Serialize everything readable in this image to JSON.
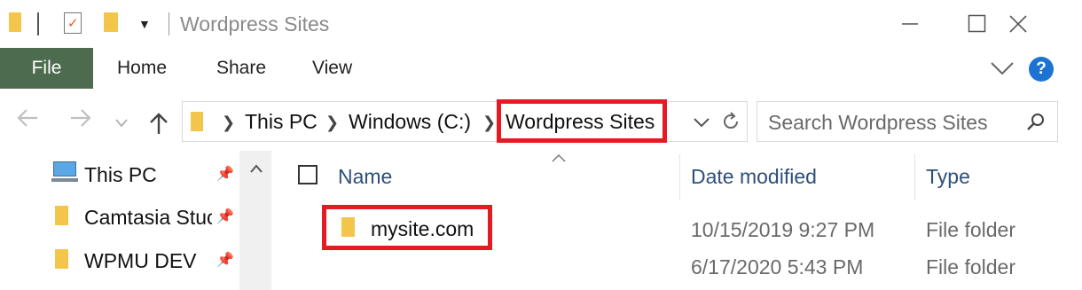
{
  "window": {
    "title": "Wordpress Sites"
  },
  "ribbon": {
    "file_label": "File",
    "tabs": [
      {
        "label": "Home"
      },
      {
        "label": "Share"
      },
      {
        "label": "View"
      }
    ],
    "help_label": "?"
  },
  "address": {
    "crumbs": [
      {
        "label": "This PC"
      },
      {
        "label": "Windows (C:)"
      },
      {
        "label": "Wordpress Sites"
      }
    ],
    "search_placeholder": "Search Wordpress Sites"
  },
  "nav_pane": {
    "items": [
      {
        "label": "This PC",
        "icon": "computer-icon",
        "pinned": true
      },
      {
        "label": "Camtasia Stuc",
        "icon": "folder-icon",
        "pinned": true
      },
      {
        "label": "WPMU DEV",
        "icon": "folder-icon",
        "pinned": true
      }
    ]
  },
  "file_list": {
    "columns": [
      {
        "label": "Name"
      },
      {
        "label": "Date modified"
      },
      {
        "label": "Type"
      }
    ],
    "rows": [
      {
        "name": "mysite.com",
        "date": "10/15/2019 9:27 PM",
        "type": "File folder"
      },
      {
        "name": "",
        "date": "6/17/2020 5:43 PM",
        "type": "File folder"
      }
    ]
  },
  "colors": {
    "file_tab": "#4d6b4f",
    "highlight": "#e51b24",
    "folder": "#f3c54a",
    "column_header": "#2d4f78",
    "help": "#1d73d1"
  }
}
